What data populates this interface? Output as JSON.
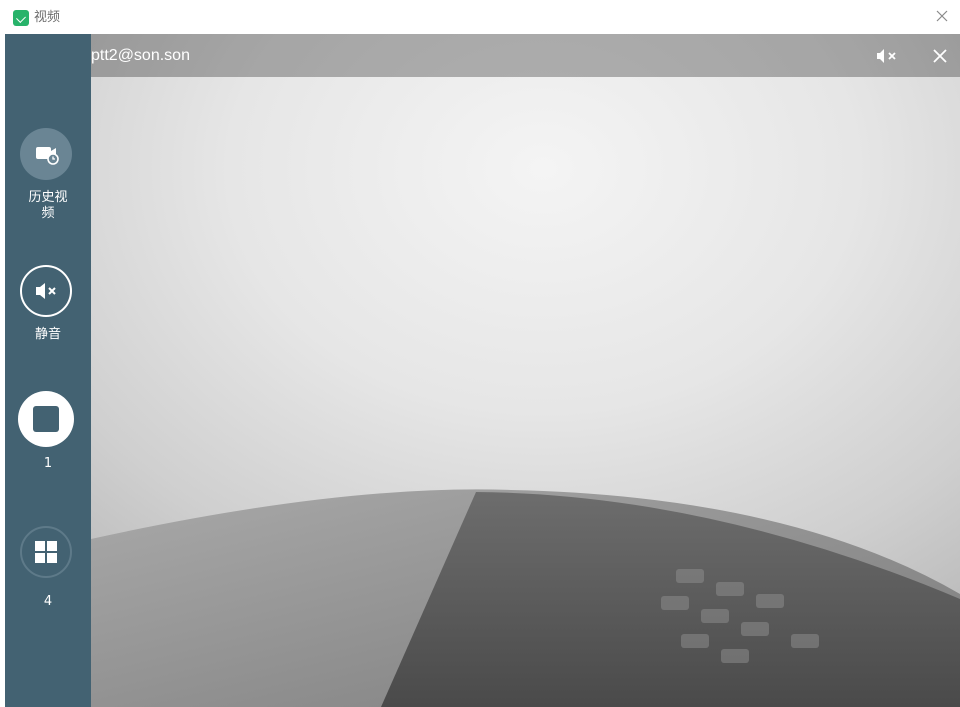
{
  "window": {
    "title": "视频",
    "icons": {
      "app": "video-app-icon",
      "close": "close-icon"
    }
  },
  "sidebar": {
    "history": {
      "label": "历史视频",
      "icon": "video-history-icon"
    },
    "mute": {
      "label": "静音",
      "icon": "mute-icon"
    },
    "layout_single": {
      "label": "1",
      "icon": "single-view-icon",
      "selected": true
    },
    "layout_quad": {
      "label": "4",
      "icon": "quad-view-icon"
    }
  },
  "video": {
    "caller": "ptt2@son.son",
    "icons": {
      "mute": "speaker-mute-icon",
      "close": "close-icon"
    }
  },
  "colors": {
    "sidebar": "#436272",
    "accent": "#27b36a"
  }
}
